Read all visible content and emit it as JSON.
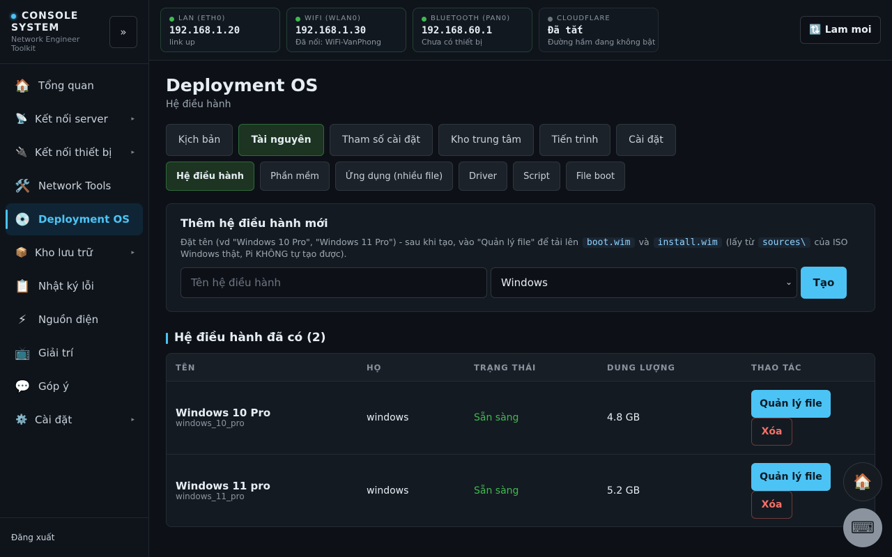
{
  "brand": {
    "title": "CONSOLE SYSTEM",
    "subtitle": "Network Engineer Toolkit",
    "collapse_label": "»"
  },
  "sidebar": {
    "items": [
      {
        "label": "Tổng quan",
        "icon": "🏠"
      },
      {
        "label": "Kết nối server",
        "icon": "📡"
      },
      {
        "label": "Kết nối thiết bị",
        "icon": "🔌"
      },
      {
        "label": "Network Tools",
        "icon": "🛠️"
      },
      {
        "label": "Deployment OS",
        "icon": "💿"
      },
      {
        "label": "Kho lưu trữ",
        "icon": "📦"
      },
      {
        "label": "Nhật ký lỗi",
        "icon": "📋"
      },
      {
        "label": "Nguồn điện",
        "icon": "⚡"
      },
      {
        "label": "Giải trí",
        "icon": "📺"
      },
      {
        "label": "Góp ý",
        "icon": "💬"
      },
      {
        "label": "Cài đặt",
        "icon": "⚙️"
      }
    ],
    "expand_arrow": "▸",
    "logout": "Đăng xuất"
  },
  "topbar": {
    "cards": [
      {
        "label": "LAN (ETH0)",
        "value": "192.168.1.20",
        "sub": "link up"
      },
      {
        "label": "WIFI (WLAN0)",
        "value": "192.168.1.30",
        "sub": "Đã nối: WiFi-VanPhong"
      },
      {
        "label": "BLUETOOTH (PAN0)",
        "value": "192.168.60.1",
        "sub": "Chưa có thiết bị"
      },
      {
        "label": "CLOUDFLARE",
        "value": "Đã tắt",
        "sub": "Đường hầm đang không bật"
      }
    ],
    "refresh_label": "🔃 Lam moi"
  },
  "page": {
    "title": "Deployment OS",
    "subtitle": "Hệ điều hành"
  },
  "tabs": [
    "Kịch bản",
    "Tài nguyên",
    "Tham số cài đặt",
    "Kho trung tâm",
    "Tiến trình",
    "Cài đặt"
  ],
  "subtabs": [
    "Hệ điều hành",
    "Phần mềm",
    "Ứng dụng (nhiều file)",
    "Driver",
    "Script",
    "File boot"
  ],
  "add_form": {
    "title": "Thêm hệ điều hành mới",
    "desc_1": "Đặt tên (vd \"Windows 10 Pro\", \"Windows 11 Pro\") - sau khi tạo, vào \"Quản lý file\" để tải lên",
    "code_1": "boot.wim",
    "desc_2": "và",
    "code_2": "install.wim",
    "desc_3": "(lấy từ",
    "code_3": "sources\\",
    "desc_4": "của ISO Windows thật, Pi KHÔNG tự tạo được).",
    "name_placeholder": "Tên hệ điều hành",
    "family_selected": "Windows",
    "create_label": "Tạo"
  },
  "list": {
    "title": "Hệ điều hành đã có (2)",
    "columns": [
      "TÊN",
      "HỌ",
      "TRẠNG THÁI",
      "DUNG LƯỢNG",
      "THAO TÁC"
    ],
    "rows": [
      {
        "name": "Windows 10 Pro",
        "id": "windows_10_pro",
        "family": "windows",
        "status": "Sẵn sàng",
        "size": "4.8 GB"
      },
      {
        "name": "Windows 11 pro",
        "id": "windows_11_pro",
        "family": "windows",
        "status": "Sẵn sàng",
        "size": "5.2 GB"
      }
    ],
    "manage_label": "Quản lý file",
    "delete_label": "Xóa"
  },
  "fabs": {
    "home_icon": "🏠",
    "keyboard_icon": "⌨"
  }
}
